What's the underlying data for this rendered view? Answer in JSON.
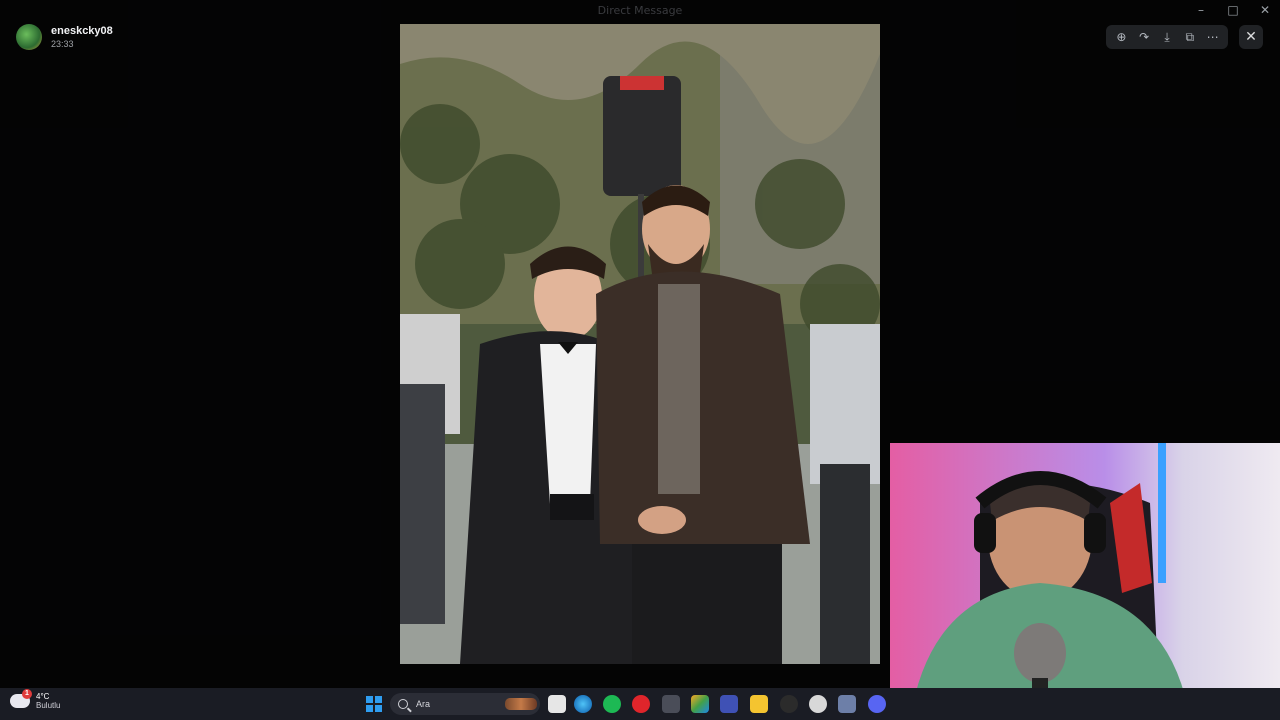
{
  "window": {
    "title": "Direct Message"
  },
  "viewer": {
    "user_name": "eneskcky08",
    "timestamp": "23:33"
  },
  "toolbar": {
    "icons": [
      "zoom-in-icon",
      "forward-icon",
      "download-icon",
      "open-external-icon",
      "more-icon"
    ],
    "close_icon": "close-icon"
  },
  "taskbar": {
    "weather_temp": "4°C",
    "weather_desc": "Bulutlu",
    "weather_badge": "1",
    "search_placeholder": "Ara"
  },
  "colors": {
    "accent": "#2f9df0",
    "toolbar_bg": "#202225"
  }
}
